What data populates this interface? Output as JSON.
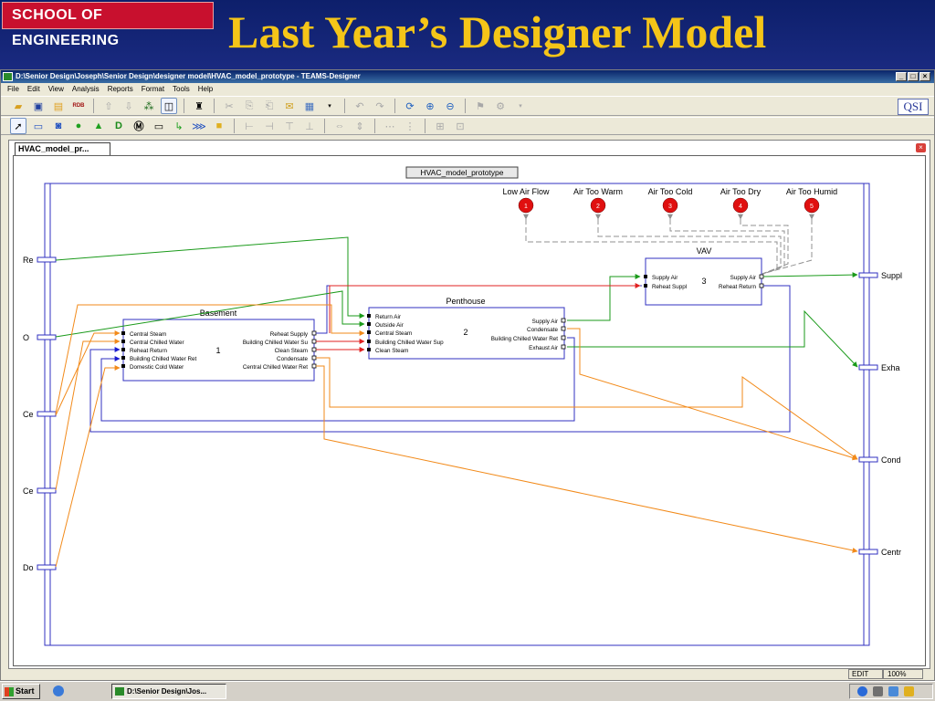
{
  "slide": {
    "badge": "SCHOOL OF ENGINEERING",
    "title": "Last Year’s Designer Model"
  },
  "window": {
    "title": "D:\\Senior Design\\Joseph\\Senior Design\\designer model\\HVAC_model_prototype - TEAMS-Designer",
    "buttons": [
      "_",
      "□",
      "×"
    ]
  },
  "menu": [
    "File",
    "Edit",
    "View",
    "Analysis",
    "Reports",
    "Format",
    "Tools",
    "Help"
  ],
  "toolbar": {
    "logo": "QSI",
    "rdb_label": "RDB"
  },
  "document": {
    "tab": "HVAC_model_pr...",
    "model_name": "HVAC_model_prototype"
  },
  "tests": [
    {
      "label": "Low Air Flow",
      "number": "1"
    },
    {
      "label": "Air Too Warm",
      "number": "2"
    },
    {
      "label": "Air Too Cold",
      "number": "3"
    },
    {
      "label": "Air Too Dry",
      "number": "4"
    },
    {
      "label": "Air Too Humid",
      "number": "5"
    }
  ],
  "left_ports": [
    "Re",
    "O",
    "Ce",
    "Ce",
    "Do"
  ],
  "right_ports": [
    "Suppl",
    "Exha",
    "Cond",
    "Centr"
  ],
  "modules": {
    "basement": {
      "title": "Basement",
      "number": "1",
      "inputs": [
        "Central Steam",
        "Central Chilled Water",
        "Reheat Return",
        "Building Chilled Water Ret",
        "Domestic Cold Water"
      ],
      "outputs": [
        "Reheat Supply",
        "Building Chilled Water Su",
        "Clean Steam",
        "Condensate",
        "Central Chilled Water Ret"
      ]
    },
    "penthouse": {
      "title": "Penthouse",
      "number": "2",
      "inputs": [
        "Return Air",
        "Outside Air",
        "Central Steam",
        "Building Chilled Water Sup",
        "Clean Steam"
      ],
      "outputs": [
        "Supply Air",
        "Condensate",
        "Building Chilled Water Ret",
        "Exhaust Air"
      ]
    },
    "vav": {
      "title": "VAV",
      "number": "3",
      "inputs": [
        "Supply Air",
        "Reheat Suppl"
      ],
      "outputs": [
        "Supply Air",
        "Reheat Return"
      ]
    }
  },
  "status": {
    "mode": "EDIT",
    "zoom": "100%"
  },
  "taskbar": {
    "start": "Start",
    "task": "D:\\Senior Design\\Jos..."
  },
  "colors": {
    "slide_bg": "#0d1f6b",
    "title_gold": "#f5c518",
    "badge_red": "#c8102e",
    "wire_orange": "#f28a1a",
    "wire_green": "#1a9a1a",
    "wire_red": "#e02020",
    "wire_blue": "#1a1ad0",
    "box_blue": "#3030c0",
    "test_red": "#e01010"
  }
}
